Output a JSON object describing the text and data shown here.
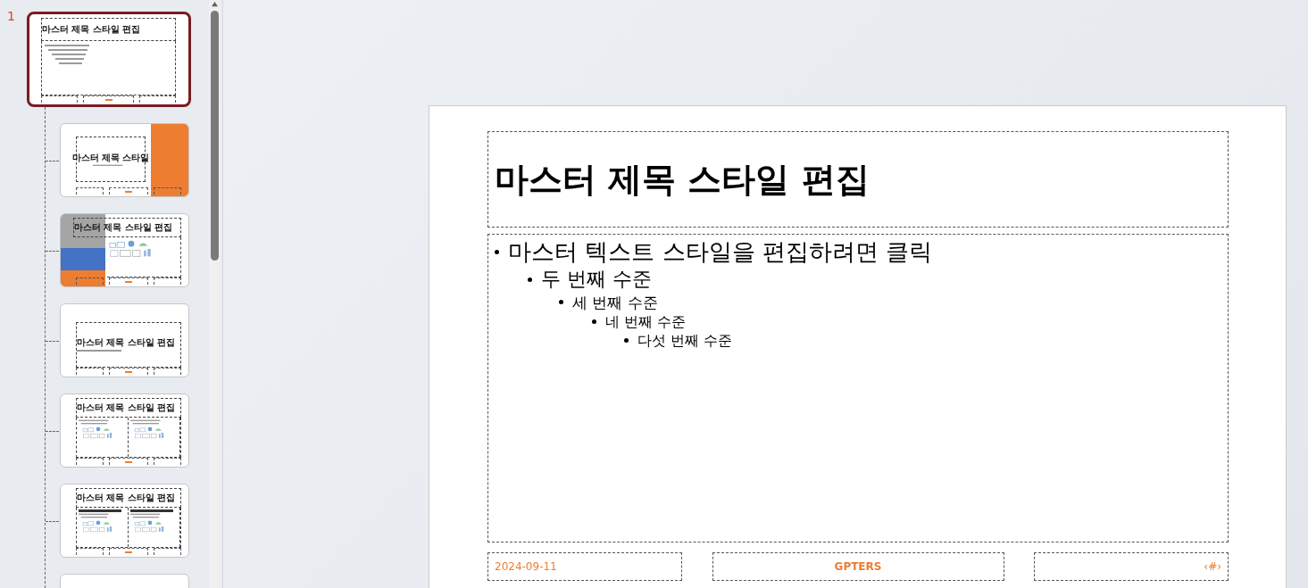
{
  "thumbnails": [
    {
      "kind": "title-content",
      "number": "1",
      "title": "마스터 제목 스타일 편집",
      "selected": true
    },
    {
      "kind": "title-slide",
      "title": "마스터 제목 스타일",
      "selected": false
    },
    {
      "kind": "picture-left",
      "title": "마스터 제목 스타일 편집",
      "selected": false
    },
    {
      "kind": "section-header",
      "title": "마스터 제목 스타일 편집",
      "selected": false
    },
    {
      "kind": "two-content",
      "title": "마스터 제목 스타일 편집",
      "selected": false
    },
    {
      "kind": "comparison",
      "title": "마스터 제목 스타일 편집",
      "selected": false
    },
    {
      "kind": "blank",
      "selected": false
    }
  ],
  "slide": {
    "title": "마스터 제목 스타일 편집",
    "levels": [
      {
        "text": "마스터 텍스트 스타일을 편집하려면 클릭",
        "children": [
          {
            "text": "두 번째 수준",
            "children": [
              {
                "text": "세 번째 수준",
                "children": [
                  {
                    "text": "네 번째 수준",
                    "children": [
                      {
                        "text": "다섯 번째 수준"
                      }
                    ]
                  }
                ]
              }
            ]
          }
        ]
      }
    ],
    "footer": {
      "date": "2024-09-11",
      "center": "GPTERS",
      "page": "‹#›"
    }
  }
}
